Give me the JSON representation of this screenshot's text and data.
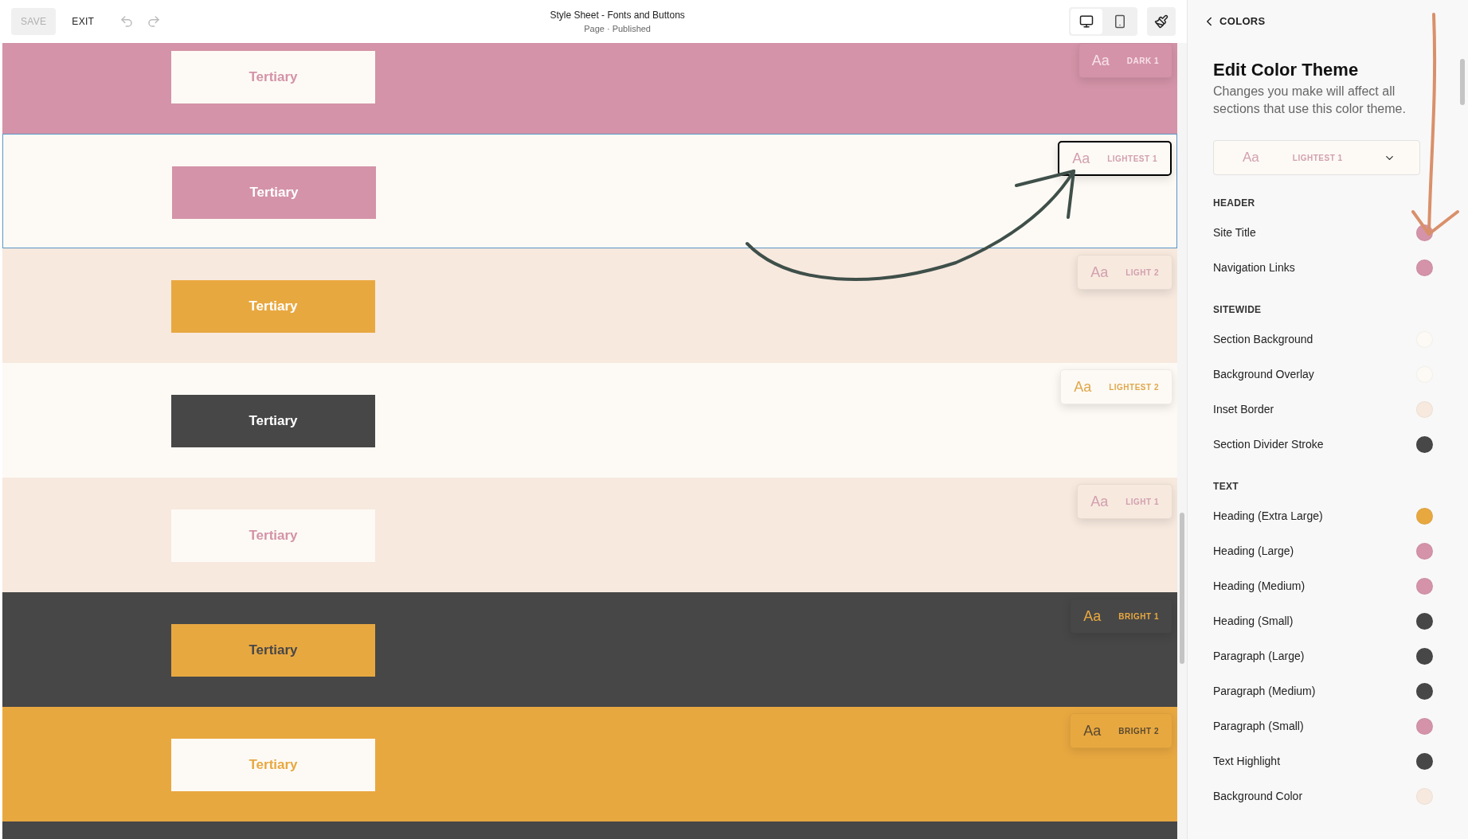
{
  "toolbar": {
    "save": {
      "label": "SAVE",
      "disabled": true
    },
    "exit": {
      "label": "EXIT"
    },
    "undo": {
      "disabled": true
    },
    "redo": {
      "disabled": true
    },
    "title": "Style Sheet - Fonts and Buttons",
    "subtitle": "Page · Published",
    "views": [
      {
        "kind": "desktop",
        "selected": true
      },
      {
        "kind": "mobile",
        "selected": false
      }
    ]
  },
  "sections": [
    {
      "color": "#d493a8",
      "selected": false,
      "button": {
        "label": "Tertiary",
        "color": "#fdfaf5",
        "kind": "inverse"
      },
      "badge": {
        "sample": "Aa",
        "label": "DARK 1",
        "color": "#f7e1e8"
      }
    },
    {
      "color": "#fdfaf5",
      "selected": true,
      "button": {
        "label": "Tertiary",
        "color": "#d493a8",
        "kind": "light"
      },
      "badge": {
        "sample": "Aa",
        "label": "LIGHTEST 1",
        "color": "#d2a0b0"
      }
    },
    {
      "color": "#f7e9de",
      "selected": false,
      "button": {
        "label": "Tertiary",
        "color": "#e8a840",
        "kind": "light"
      },
      "badge": {
        "sample": "Aa",
        "label": "LIGHT 2",
        "color": "#d2a0b0"
      }
    },
    {
      "color": "#fdfaf5",
      "selected": false,
      "button": {
        "label": "Tertiary",
        "color": "#474747",
        "kind": "light"
      },
      "badge": {
        "sample": "Aa",
        "label": "LIGHTEST 2",
        "color": "#e0a84c"
      }
    },
    {
      "color": "#f7e9de",
      "selected": false,
      "button": {
        "label": "Tertiary",
        "color": "#fdfaf5",
        "kind": "accent"
      },
      "badge": {
        "sample": "Aa",
        "label": "LIGHT 1",
        "color": "#d2a0b0"
      }
    },
    {
      "color": "#474747",
      "selected": false,
      "button": {
        "label": "Tertiary",
        "color": "#e8a840",
        "kind": "inverse"
      },
      "badge": {
        "sample": "Aa",
        "label": "BRIGHT 1",
        "color": "#e8a840"
      }
    },
    {
      "color": "#e8a840",
      "selected": false,
      "button": {
        "label": "Tertiary",
        "color": "#fdfaf5",
        "kind": "inverse"
      },
      "badge": {
        "sample": "Aa",
        "label": "BRIGHT 2",
        "color": "#5a4a30"
      }
    },
    {
      "color": "#474747",
      "selected": false
    }
  ],
  "panel": {
    "back": "COLORS",
    "title": "Edit Color Theme",
    "description": "Changes you make will affect all sections that use this color theme.",
    "theme_select": {
      "sample": "Aa",
      "label": "LIGHTEST 1"
    },
    "groups": [
      {
        "heading": "HEADER",
        "items": [
          {
            "label": "Site Title",
            "color": "#d493a8"
          },
          {
            "label": "Navigation Links",
            "color": "#d493a8"
          }
        ]
      },
      {
        "heading": "SITEWIDE",
        "items": [
          {
            "label": "Section Background",
            "color": "#fdfaf5"
          },
          {
            "label": "Background Overlay",
            "color": "#fdfaf5"
          },
          {
            "label": "Inset Border",
            "color": "#f7e9de"
          },
          {
            "label": "Section Divider Stroke",
            "color": "#474747"
          }
        ]
      },
      {
        "heading": "TEXT",
        "items": [
          {
            "label": "Heading (Extra Large)",
            "color": "#e8a840"
          },
          {
            "label": "Heading (Large)",
            "color": "#d493a8"
          },
          {
            "label": "Heading (Medium)",
            "color": "#d493a8"
          },
          {
            "label": "Heading (Small)",
            "color": "#474747"
          },
          {
            "label": "Paragraph (Large)",
            "color": "#474747"
          },
          {
            "label": "Paragraph (Medium)",
            "color": "#474747"
          },
          {
            "label": "Paragraph (Small)",
            "color": "#d493a8"
          },
          {
            "label": "Text Highlight",
            "color": "#474747"
          },
          {
            "label": "Background Color",
            "color": "#f7e9de"
          }
        ]
      }
    ]
  }
}
